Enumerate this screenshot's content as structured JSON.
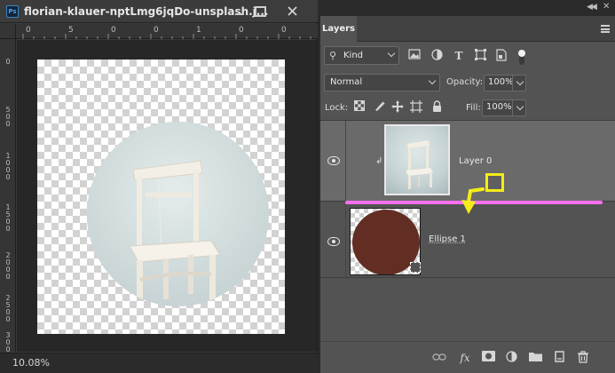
{
  "document": {
    "title": "florian-klauer-nptLmg6jqDo-unsplash.j...",
    "app_badge": "Ps",
    "zoom_level": "10.08%",
    "ruler_h_labels": [
      "0",
      "5",
      "0",
      "0",
      "1",
      "0",
      "0",
      "0",
      "1",
      "5",
      "0",
      "0"
    ],
    "ruler_v_labels": [
      "0",
      "500",
      "1000",
      "1500",
      "2000",
      "2500",
      "3000"
    ]
  },
  "panel": {
    "tab_label": "Layers",
    "filter": {
      "kind_label": "Kind",
      "icons": [
        "image-filter-icon",
        "adjustment-filter-icon",
        "type-filter-icon",
        "shape-filter-icon",
        "smart-object-filter-icon",
        "filter-toggle-icon"
      ]
    },
    "blend_mode": "Normal",
    "opacity_label": "Opacity:",
    "opacity_value": "100%",
    "lock_label": "Lock:",
    "fill_label": "Fill:",
    "fill_value": "100%",
    "layers": [
      {
        "name": "Layer 0",
        "visible": true,
        "clipped": true,
        "selected": true
      },
      {
        "name": "Ellipse 1",
        "visible": true,
        "clipped": false,
        "selected": false,
        "swatch_color": "#622e24"
      }
    ],
    "bottom_icons": [
      "link-layers-icon",
      "fx-icon",
      "layer-mask-icon",
      "adjustment-layer-icon",
      "group-folder-icon",
      "new-layer-icon",
      "trash-icon"
    ]
  },
  "annotations": {
    "highlight_line_color": "#ff6ff0",
    "marker_color": "#f5ec19"
  },
  "colors": {
    "accent_blue": "#3a87c8",
    "panel_bg": "#535353",
    "selected_layer_bg": "#6a6a6a"
  }
}
